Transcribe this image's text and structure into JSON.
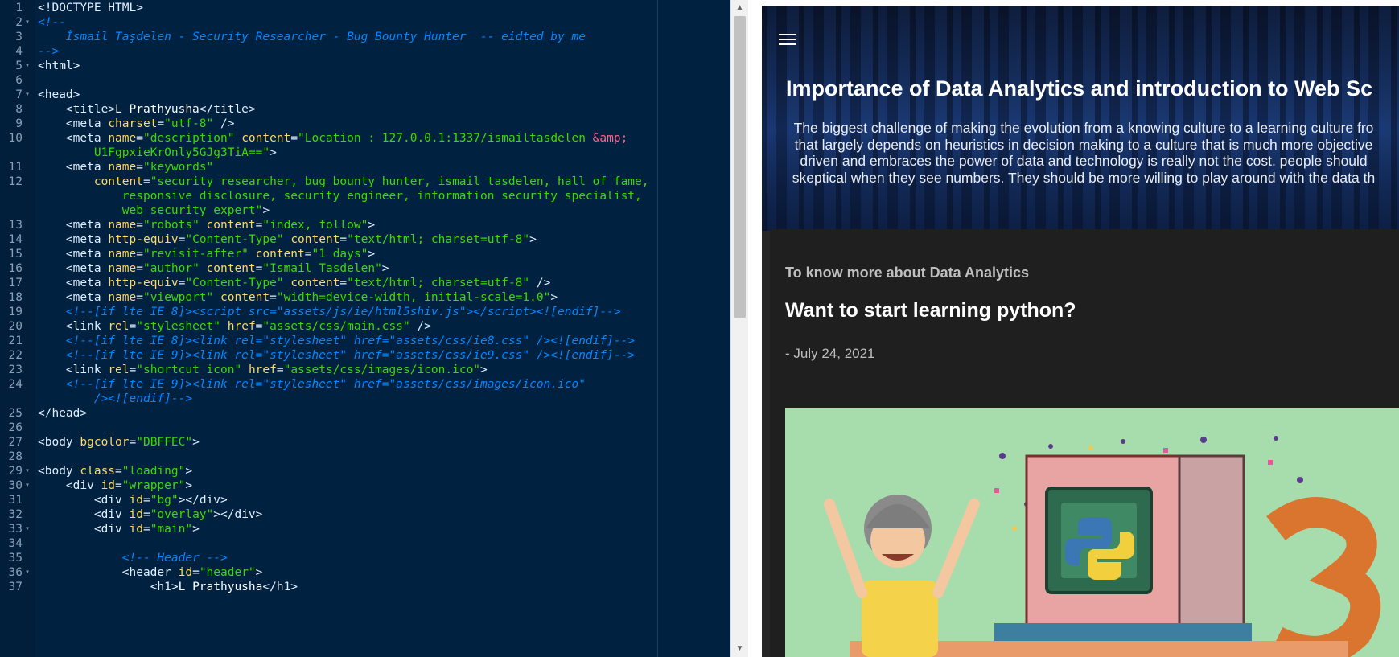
{
  "editor": {
    "lines": [
      {
        "n": "1",
        "fold": false,
        "html": "<span class=\"tg\">&lt;!DOCTYPE HTML&gt;</span>"
      },
      {
        "n": "2",
        "fold": true,
        "html": "<span class=\"cm\">&lt;!--</span>"
      },
      {
        "n": "3",
        "fold": false,
        "html": "<span class=\"cm\">    İsmail Taşdelen - Security Researcher - Bug Bounty Hunter  -- eidted by me</span>"
      },
      {
        "n": "4",
        "fold": false,
        "html": "<span class=\"cm\">--&gt;</span>"
      },
      {
        "n": "5",
        "fold": true,
        "html": "<span class=\"tg\">&lt;html&gt;</span>"
      },
      {
        "n": "6",
        "fold": false,
        "html": ""
      },
      {
        "n": "7",
        "fold": true,
        "html": "<span class=\"tg\">&lt;head&gt;</span>"
      },
      {
        "n": "8",
        "fold": false,
        "html": "    <span class=\"tg\">&lt;title&gt;</span><span class=\"tx\">L Prathyusha</span><span class=\"tg\">&lt;/title&gt;</span>"
      },
      {
        "n": "9",
        "fold": false,
        "html": "    <span class=\"tg\">&lt;meta </span><span class=\"at\">charset</span><span class=\"tg\">=</span><span class=\"st\">\"utf-8\"</span><span class=\"tg\"> /&gt;</span>"
      },
      {
        "n": "10",
        "fold": false,
        "html": "    <span class=\"tg\">&lt;meta </span><span class=\"at\">name</span><span class=\"tg\">=</span><span class=\"st\">\"description\"</span><span class=\"tg\"> </span><span class=\"at\">content</span><span class=\"tg\">=</span><span class=\"st\">\"Location : 127.0.0.1:1337/ismailtasdelen </span><span class=\"en\">&amp;amp;</span>"
      },
      {
        "n": "",
        "fold": false,
        "html": "        <span class=\"st\">U1FgpxieKrOnly5GJg3TiA==\"</span><span class=\"tg\">&gt;</span>"
      },
      {
        "n": "11",
        "fold": false,
        "html": "    <span class=\"tg\">&lt;meta </span><span class=\"at\">name</span><span class=\"tg\">=</span><span class=\"st\">\"keywords\"</span>"
      },
      {
        "n": "12",
        "fold": false,
        "html": "        <span class=\"at\">content</span><span class=\"tg\">=</span><span class=\"st\">\"security researcher, bug bounty hunter, ismail tasdelen, hall of fame,</span>"
      },
      {
        "n": "",
        "fold": false,
        "html": "            <span class=\"st\">responsive disclosure, security engineer, information security specialist,</span>"
      },
      {
        "n": "",
        "fold": false,
        "html": "            <span class=\"st\">web security expert\"</span><span class=\"tg\">&gt;</span>"
      },
      {
        "n": "13",
        "fold": false,
        "html": "    <span class=\"tg\">&lt;meta </span><span class=\"at\">name</span><span class=\"tg\">=</span><span class=\"st\">\"robots\"</span><span class=\"tg\"> </span><span class=\"at\">content</span><span class=\"tg\">=</span><span class=\"st\">\"index, follow\"</span><span class=\"tg\">&gt;</span>"
      },
      {
        "n": "14",
        "fold": false,
        "html": "    <span class=\"tg\">&lt;meta </span><span class=\"at\">http-equiv</span><span class=\"tg\">=</span><span class=\"st\">\"Content-Type\"</span><span class=\"tg\"> </span><span class=\"at\">content</span><span class=\"tg\">=</span><span class=\"st\">\"text/html; charset=utf-8\"</span><span class=\"tg\">&gt;</span>"
      },
      {
        "n": "15",
        "fold": false,
        "html": "    <span class=\"tg\">&lt;meta </span><span class=\"at\">name</span><span class=\"tg\">=</span><span class=\"st\">\"revisit-after\"</span><span class=\"tg\"> </span><span class=\"at\">content</span><span class=\"tg\">=</span><span class=\"st\">\"1 days\"</span><span class=\"tg\">&gt;</span>"
      },
      {
        "n": "16",
        "fold": false,
        "html": "    <span class=\"tg\">&lt;meta </span><span class=\"at\">name</span><span class=\"tg\">=</span><span class=\"st\">\"author\"</span><span class=\"tg\"> </span><span class=\"at\">content</span><span class=\"tg\">=</span><span class=\"st\">\"Ismail Tasdelen\"</span><span class=\"tg\">&gt;</span>"
      },
      {
        "n": "17",
        "fold": false,
        "html": "    <span class=\"tg\">&lt;meta </span><span class=\"at\">http-equiv</span><span class=\"tg\">=</span><span class=\"st\">\"Content-Type\"</span><span class=\"tg\"> </span><span class=\"at\">content</span><span class=\"tg\">=</span><span class=\"st\">\"text/html; charset=utf-8\"</span><span class=\"tg\"> /&gt;</span>"
      },
      {
        "n": "18",
        "fold": false,
        "html": "    <span class=\"tg\">&lt;meta </span><span class=\"at\">name</span><span class=\"tg\">=</span><span class=\"st\">\"viewport\"</span><span class=\"tg\"> </span><span class=\"at\">content</span><span class=\"tg\">=</span><span class=\"st\">\"width=device-width, initial-scale=1.0\"</span><span class=\"tg\">&gt;</span>"
      },
      {
        "n": "19",
        "fold": false,
        "html": "    <span class=\"cm\">&lt;!--[if lte IE 8]&gt;&lt;script src=\"assets/js/ie/html5shiv.js\"&gt;&lt;/script&gt;&lt;![endif]--&gt;</span>"
      },
      {
        "n": "20",
        "fold": false,
        "html": "    <span class=\"tg\">&lt;link </span><span class=\"at\">rel</span><span class=\"tg\">=</span><span class=\"st\">\"stylesheet\"</span><span class=\"tg\"> </span><span class=\"at\">href</span><span class=\"tg\">=</span><span class=\"st\">\"assets/css/main.css\"</span><span class=\"tg\"> /&gt;</span>"
      },
      {
        "n": "21",
        "fold": false,
        "html": "    <span class=\"cm\">&lt;!--[if lte IE 8]&gt;&lt;link rel=\"stylesheet\" href=\"assets/css/ie8.css\" /&gt;&lt;![endif]--&gt;</span>"
      },
      {
        "n": "22",
        "fold": false,
        "html": "    <span class=\"cm\">&lt;!--[if lte IE 9]&gt;&lt;link rel=\"stylesheet\" href=\"assets/css/ie9.css\" /&gt;&lt;![endif]--&gt;</span>"
      },
      {
        "n": "23",
        "fold": false,
        "html": "    <span class=\"tg\">&lt;link </span><span class=\"at\">rel</span><span class=\"tg\">=</span><span class=\"st\">\"shortcut icon\"</span><span class=\"tg\"> </span><span class=\"at\">href</span><span class=\"tg\">=</span><span class=\"st\">\"assets/css/images/icon.ico\"</span><span class=\"tg\">&gt;</span>"
      },
      {
        "n": "24",
        "fold": false,
        "html": "    <span class=\"cm\">&lt;!--[if lte IE 9]&gt;&lt;link rel=\"stylesheet\" href=\"assets/css/images/icon.ico\"</span>"
      },
      {
        "n": "",
        "fold": false,
        "html": "        <span class=\"cm\">/&gt;&lt;![endif]--&gt;</span>"
      },
      {
        "n": "25",
        "fold": false,
        "html": "<span class=\"tg\">&lt;/head&gt;</span>"
      },
      {
        "n": "26",
        "fold": false,
        "html": ""
      },
      {
        "n": "27",
        "fold": false,
        "html": "<span class=\"tg\">&lt;body </span><span class=\"at\">bgcolor</span><span class=\"tg\">=</span><span class=\"st\">\"DBFFEC\"</span><span class=\"tg\">&gt;</span>"
      },
      {
        "n": "28",
        "fold": false,
        "html": ""
      },
      {
        "n": "29",
        "fold": true,
        "html": "<span class=\"tg\">&lt;body </span><span class=\"at\">class</span><span class=\"tg\">=</span><span class=\"st\">\"loading\"</span><span class=\"tg\">&gt;</span>"
      },
      {
        "n": "30",
        "fold": true,
        "html": "    <span class=\"tg\">&lt;div </span><span class=\"at\">id</span><span class=\"tg\">=</span><span class=\"st\">\"wrapper\"</span><span class=\"tg\">&gt;</span>"
      },
      {
        "n": "31",
        "fold": false,
        "html": "        <span class=\"tg\">&lt;div </span><span class=\"at\">id</span><span class=\"tg\">=</span><span class=\"st\">\"bg\"</span><span class=\"tg\">&gt;&lt;/div&gt;</span>"
      },
      {
        "n": "32",
        "fold": false,
        "html": "        <span class=\"tg\">&lt;div </span><span class=\"at\">id</span><span class=\"tg\">=</span><span class=\"st\">\"overlay\"</span><span class=\"tg\">&gt;&lt;/div&gt;</span>"
      },
      {
        "n": "33",
        "fold": true,
        "html": "        <span class=\"tg\">&lt;div </span><span class=\"at\">id</span><span class=\"tg\">=</span><span class=\"st\">\"main\"</span><span class=\"tg\">&gt;</span>"
      },
      {
        "n": "34",
        "fold": false,
        "html": ""
      },
      {
        "n": "35",
        "fold": false,
        "html": "            <span class=\"cm\">&lt;!-- Header --&gt;</span>"
      },
      {
        "n": "36",
        "fold": true,
        "html": "            <span class=\"tg\">&lt;header </span><span class=\"at\">id</span><span class=\"tg\">=</span><span class=\"st\">\"header\"</span><span class=\"tg\">&gt;</span>"
      },
      {
        "n": "37",
        "fold": false,
        "html": "                <span class=\"tg\">&lt;h1&gt;</span><span class=\"tx\">L Prathyusha</span><span class=\"tg\">&lt;/h1&gt;</span>"
      }
    ]
  },
  "preview": {
    "menu_icon": "hamburger-menu-icon",
    "hero_title": "Importance of Data Analytics and introduction to Web Sc",
    "hero_description_lines": [
      "The biggest challenge of making the evolution from a knowing culture to a learning culture fro",
      "that largely depends on heuristics in decision making to a culture that is much more objective",
      "driven and embraces the power of data and technology is really not the cost. people should",
      "skeptical when they see numbers. They should be more willing to play around with the data th"
    ],
    "card_subtitle": "To know more about Data Analytics",
    "card_title": "Want to start learning python?",
    "card_date": "- July 24, 2021",
    "image_icon": "python-illustration"
  },
  "colors": {
    "editor_bg": "#002240",
    "comment": "#0088ff",
    "string": "#3ad900",
    "attribute": "#ffd866",
    "preview_bg": "#1f1f1f"
  }
}
